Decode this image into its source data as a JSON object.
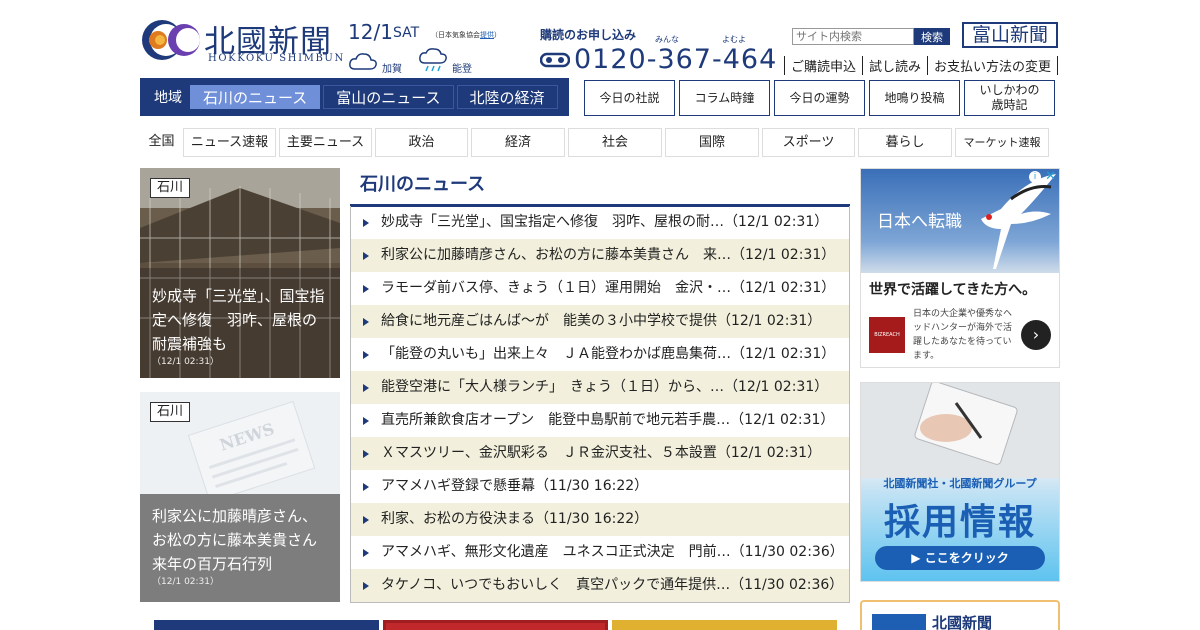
{
  "header": {
    "logo_title": "北國新聞",
    "logo_sub": "HOKKOKU SHIMBUN",
    "date": "12/1",
    "day_of_week": "SAT",
    "weather_source_prefix": "（日本気象協会",
    "weather_source_link": "提供",
    "weather_source_suffix": "）",
    "weather": [
      {
        "place": "加賀",
        "icon": "cloud-icon"
      },
      {
        "place": "能登",
        "icon": "cloud-rain-icon"
      }
    ],
    "subscribe_title": "購読のお申し込み",
    "ruby_minna": "みんな",
    "ruby_yomuyo": "よむよ",
    "phone": "0120-367-464",
    "search_placeholder": "サイト内検索",
    "search_button": "検索",
    "toyama_link": "富山新聞",
    "sublinks": [
      "ご購読申込",
      "試し読み",
      "お支払い方法の変更"
    ]
  },
  "region_nav": {
    "label": "地域",
    "tabs": [
      "石川のニュース",
      "富山のニュース",
      "北陸の経済"
    ],
    "active_index": 0
  },
  "feature_buttons": [
    "今日の社説",
    "コラム時鐘",
    "今日の運勢",
    "地鳴り投稿",
    "いしかわの\n歳時記"
  ],
  "category_nav": {
    "label": "全国",
    "items": [
      "ニュース速報",
      "主要ニュース",
      "政治",
      "経済",
      "社会",
      "国際",
      "スポーツ",
      "暮らし",
      "マーケット速報"
    ]
  },
  "photo_cards": [
    {
      "tag": "石川",
      "caption": "妙成寺「三光堂」、国宝指定へ修復　羽咋、屋根の耐震補強も",
      "time": "（12/1 02:31）"
    },
    {
      "tag": "石川",
      "caption": "利家公に加藤晴彦さん、お松の方に藤本美貴さん　来年の百万石行列",
      "time": "（12/1 02:31）"
    }
  ],
  "news": {
    "heading": "石川のニュース",
    "items": [
      "妙成寺「三光堂」、国宝指定へ修復　羽咋、屋根の耐…（12/1 02:31）",
      "利家公に加藤晴彦さん、お松の方に藤本美貴さん　来…（12/1 02:31）",
      "ラモーダ前バス停、きょう（１日）運用開始　金沢・…（12/1 02:31）",
      "給食に地元産ごはんば～が　能美の３小中学校で提供（12/1 02:31）",
      "「能登の丸いも」出来上々　ＪＡ能登わかば鹿島集荷…（12/1 02:31）",
      "能登空港に「大人様ランチ」　きょう（１日）から、…（12/1 02:31）",
      "直売所兼飲食店オープン　能登中島駅前で地元若手農…（12/1 02:31）",
      "Ｘマスツリー、金沢駅彩る　ＪＲ金沢支社、５本設置（12/1 02:31）",
      "アマメハギ登録で懸垂幕（11/30 16:22）",
      "利家、お松の方役決まる（11/30 16:22）",
      "アマメハギ、無形文化遺産　ユネスコ正式決定　門前…（11/30 02:36）",
      "タケノコ、いつでもおいしく　真空パックで通年提供…（11/30 02:36）"
    ]
  },
  "ads": {
    "ad1_image_text": "日本へ転職",
    "ad1_headline": "世界で活躍してきた方へ。",
    "ad1_logo": "BIZREACH",
    "ad1_text": "日本の大企業や優秀なヘッドハンターが海外で活躍したあなたを待っています。",
    "ad1_arrow": "›",
    "ad1_info": "i",
    "ad1_close": "✕",
    "ad2_small": "北國新聞社・北國新聞グループ",
    "ad2_big": "採用情報",
    "ad2_button": "▶ ここをクリック",
    "ad3_text": "北國新聞"
  },
  "colors": {
    "brand": "#1e3a7a",
    "active_tab": "#6f8fd9",
    "row_alt": "#f2f0dc"
  }
}
